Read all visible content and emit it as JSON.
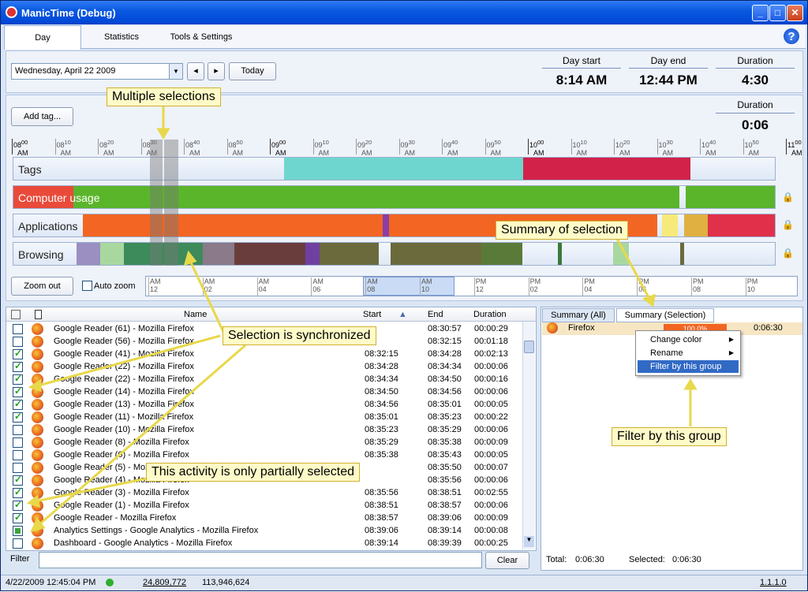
{
  "window": {
    "title": "ManicTime (Debug)",
    "minimize": "_",
    "maximize": "□",
    "close": "✕"
  },
  "tabs": [
    "Day",
    "Statistics",
    "Tools & Settings"
  ],
  "help": "?",
  "date": {
    "value": "Wednesday, April 22 2009",
    "prev": "◂",
    "next": "▸",
    "today": "Today"
  },
  "day": {
    "start_label": "Day start",
    "start": "8:14 AM",
    "end_label": "Day end",
    "end": "12:44 PM",
    "dur_label": "Duration",
    "dur": "4:30"
  },
  "selection": {
    "dur_label": "Duration",
    "dur": "0:06"
  },
  "add_tag": "Add tag...",
  "ruler": [
    {
      "h": "08",
      "m": "00",
      "major": true
    },
    {
      "h": "08",
      "m": "10"
    },
    {
      "h": "08",
      "m": "20"
    },
    {
      "h": "08",
      "m": "30"
    },
    {
      "h": "08",
      "m": "40"
    },
    {
      "h": "08",
      "m": "50"
    },
    {
      "h": "09",
      "m": "00",
      "major": true
    },
    {
      "h": "09",
      "m": "10"
    },
    {
      "h": "09",
      "m": "20"
    },
    {
      "h": "09",
      "m": "30"
    },
    {
      "h": "09",
      "m": "40"
    },
    {
      "h": "09",
      "m": "50"
    },
    {
      "h": "10",
      "m": "00",
      "major": true
    },
    {
      "h": "10",
      "m": "10"
    },
    {
      "h": "10",
      "m": "20"
    },
    {
      "h": "10",
      "m": "30"
    },
    {
      "h": "10",
      "m": "40"
    },
    {
      "h": "10",
      "m": "50"
    },
    {
      "h": "11",
      "m": "00",
      "major": true
    }
  ],
  "ampm": "AM",
  "tracks": {
    "tags": "Tags",
    "computer": "Computer usage",
    "applications": "Applications",
    "browsing": "Browsing"
  },
  "zoom_out": "Zoom out",
  "auto_zoom": "Auto zoom",
  "mini_ticks": [
    [
      "AM",
      "12"
    ],
    [
      "AM",
      "02"
    ],
    [
      "AM",
      "04"
    ],
    [
      "AM",
      "06"
    ],
    [
      "AM",
      "08"
    ],
    [
      "AM",
      "10"
    ],
    [
      "PM",
      "12"
    ],
    [
      "PM",
      "02"
    ],
    [
      "PM",
      "04"
    ],
    [
      "PM",
      "06"
    ],
    [
      "PM",
      "08"
    ],
    [
      "PM",
      "10"
    ]
  ],
  "list": {
    "headers": {
      "name": "Name",
      "start": "Start",
      "end": "End",
      "duration": "Duration"
    },
    "rows": [
      {
        "c": "",
        "n": "Google Reader (61) - Mozilla Firefox",
        "s": "",
        "e": "08:30:57",
        "d": "00:00:29"
      },
      {
        "c": "",
        "n": "Google Reader (56) - Mozilla Firefox",
        "s": "",
        "e": "08:32:15",
        "d": "00:01:18"
      },
      {
        "c": "on",
        "n": "Google Reader (41) - Mozilla Firefox",
        "s": "08:32:15",
        "e": "08:34:28",
        "d": "00:02:13"
      },
      {
        "c": "on",
        "n": "Google Reader (22) - Mozilla Firefox",
        "s": "08:34:28",
        "e": "08:34:34",
        "d": "00:00:06"
      },
      {
        "c": "on",
        "n": "Google Reader (22) - Mozilla Firefox",
        "s": "08:34:34",
        "e": "08:34:50",
        "d": "00:00:16"
      },
      {
        "c": "on",
        "n": "Google Reader (14) - Mozilla Firefox",
        "s": "08:34:50",
        "e": "08:34:56",
        "d": "00:00:06"
      },
      {
        "c": "on",
        "n": "Google Reader (13) - Mozilla Firefox",
        "s": "08:34:56",
        "e": "08:35:01",
        "d": "00:00:05"
      },
      {
        "c": "on",
        "n": "Google Reader (11) - Mozilla Firefox",
        "s": "08:35:01",
        "e": "08:35:23",
        "d": "00:00:22"
      },
      {
        "c": "",
        "n": "Google Reader (10) - Mozilla Firefox",
        "s": "08:35:23",
        "e": "08:35:29",
        "d": "00:00:06"
      },
      {
        "c": "",
        "n": "Google Reader (8) - Mozilla Firefox",
        "s": "08:35:29",
        "e": "08:35:38",
        "d": "00:00:09"
      },
      {
        "c": "",
        "n": "Google Reader (6) - Mozilla Firefox",
        "s": "08:35:38",
        "e": "08:35:43",
        "d": "00:00:05"
      },
      {
        "c": "",
        "n": "Google Reader (5) - Mozilla Firefox",
        "s": "",
        "e": "08:35:50",
        "d": "00:00:07"
      },
      {
        "c": "on",
        "n": "Google Reader (4) - Mozilla Firefox",
        "s": "",
        "e": "08:35:56",
        "d": "00:00:06"
      },
      {
        "c": "on",
        "n": "Google Reader (3) - Mozilla Firefox",
        "s": "08:35:56",
        "e": "08:38:51",
        "d": "00:02:55"
      },
      {
        "c": "on",
        "n": "Google Reader (1) - Mozilla Firefox",
        "s": "08:38:51",
        "e": "08:38:57",
        "d": "00:00:06"
      },
      {
        "c": "on",
        "n": "Google Reader - Mozilla Firefox",
        "s": "08:38:57",
        "e": "08:39:06",
        "d": "00:00:09"
      },
      {
        "c": "part",
        "n": "Analytics Settings - Google Analytics - Mozilla Firefox",
        "s": "08:39:06",
        "e": "08:39:14",
        "d": "00:00:08"
      },
      {
        "c": "",
        "n": "Dashboard - Google Analytics - Mozilla Firefox",
        "s": "08:39:14",
        "e": "08:39:39",
        "d": "00:00:25"
      }
    ]
  },
  "filter": {
    "label": "Filter",
    "clear": "Clear"
  },
  "summary": {
    "tab_all": "Summary (All)",
    "tab_sel": "Summary (Selection)",
    "item": "Firefox",
    "pct": "100.0%",
    "time": "0:06:30",
    "total_label": "Total:",
    "total": "0:06:30",
    "selected_label": "Selected:",
    "selected": "0:06:30"
  },
  "context_menu": {
    "change_color": "Change color",
    "rename": "Rename",
    "filter": "Filter by this group"
  },
  "callouts": {
    "multi": "Multiple selections",
    "summary": "Summary of selection",
    "sync": "Selection is synchronized",
    "partial": "This activity is only partially selected",
    "filter": "Filter by this group"
  },
  "status": {
    "datetime": "4/22/2009 12:45:04 PM",
    "mem1": "24,809,772",
    "mem2": "113,946,624",
    "version": "1.1.1.0"
  },
  "colors": {
    "tags_teal": "#6fd6cf",
    "tags_red": "#d2224a",
    "green": "#5ab52b",
    "orange": "#f26522",
    "olive": "#6b6a3d",
    "selection": "#787878",
    "callout_bg": "#fffbc8"
  }
}
